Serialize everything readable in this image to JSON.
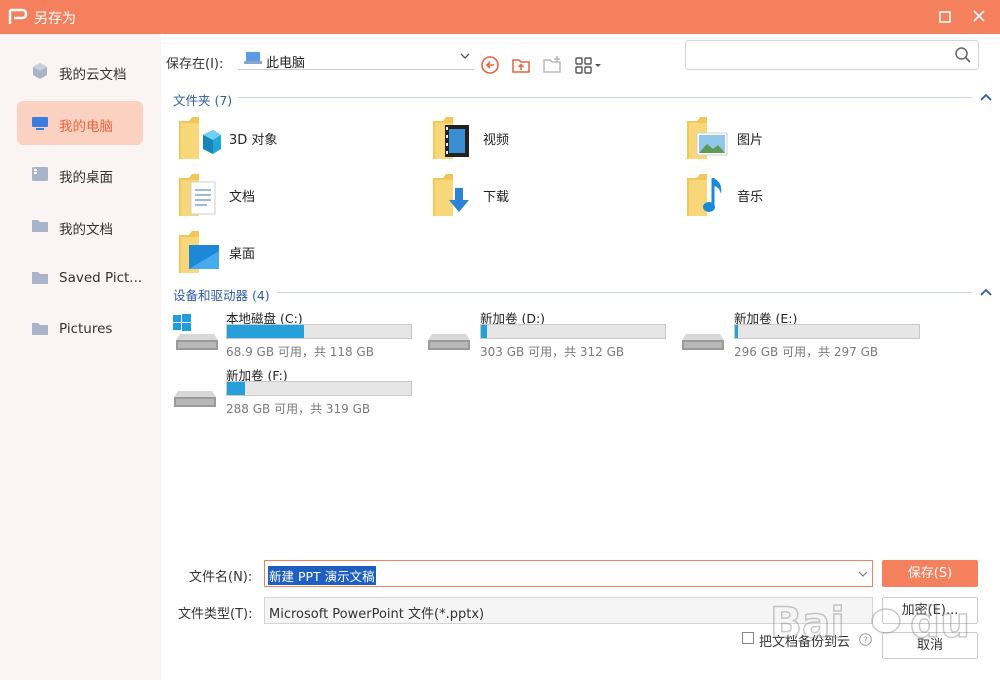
{
  "window": {
    "title": "另存为"
  },
  "sidebar": {
    "items": [
      {
        "label": "我的云文档",
        "icon": "cloud-docs-icon"
      },
      {
        "label": "我的电脑",
        "icon": "computer-icon",
        "active": true
      },
      {
        "label": "我的桌面",
        "icon": "desktop-icon"
      },
      {
        "label": "我的文档",
        "icon": "folder-icon"
      },
      {
        "label": "Saved Pict...",
        "icon": "folder-icon"
      },
      {
        "label": "Pictures",
        "icon": "folder-icon"
      }
    ]
  },
  "location": {
    "label": "保存在(I):",
    "value": "此电脑"
  },
  "search": {
    "placeholder": ""
  },
  "folders_section": {
    "title": "文件夹 (7)",
    "items": [
      {
        "label": "3D 对象",
        "icon": "3d-objects-folder-icon"
      },
      {
        "label": "视频",
        "icon": "videos-folder-icon"
      },
      {
        "label": "图片",
        "icon": "pictures-folder-icon"
      },
      {
        "label": "文档",
        "icon": "documents-folder-icon"
      },
      {
        "label": "下载",
        "icon": "downloads-folder-icon"
      },
      {
        "label": "音乐",
        "icon": "music-folder-icon"
      },
      {
        "label": "桌面",
        "icon": "desktop-folder-icon"
      }
    ]
  },
  "drives_section": {
    "title": "设备和驱动器 (4)",
    "items": [
      {
        "name": "本地磁盘 (C:)",
        "info": "68.9 GB 可用，共 118 GB",
        "used_fraction": 0.42
      },
      {
        "name": "新加卷 (D:)",
        "info": "303 GB 可用，共 312 GB",
        "used_fraction": 0.03
      },
      {
        "name": "新加卷 (E:)",
        "info": "296 GB 可用，共 297 GB",
        "used_fraction": 0.003
      },
      {
        "name": "新加卷 (F:)",
        "info": "288 GB 可用，共 319 GB",
        "used_fraction": 0.1
      }
    ]
  },
  "form": {
    "filename_label": "文件名(N):",
    "filename_value": "新建 PPT 演示文稿",
    "filetype_label": "文件类型(T):",
    "filetype_value": "Microsoft PowerPoint 文件(*.pptx)",
    "save_label": "保存(S)",
    "tools_label": "加密(E)...",
    "cancel_label": "取消",
    "cloud_backup_label": "把文档备份到云"
  },
  "colors": {
    "accent": "#f4805e",
    "link": "#2d5aa8",
    "drive_bar": "#26a0da"
  }
}
